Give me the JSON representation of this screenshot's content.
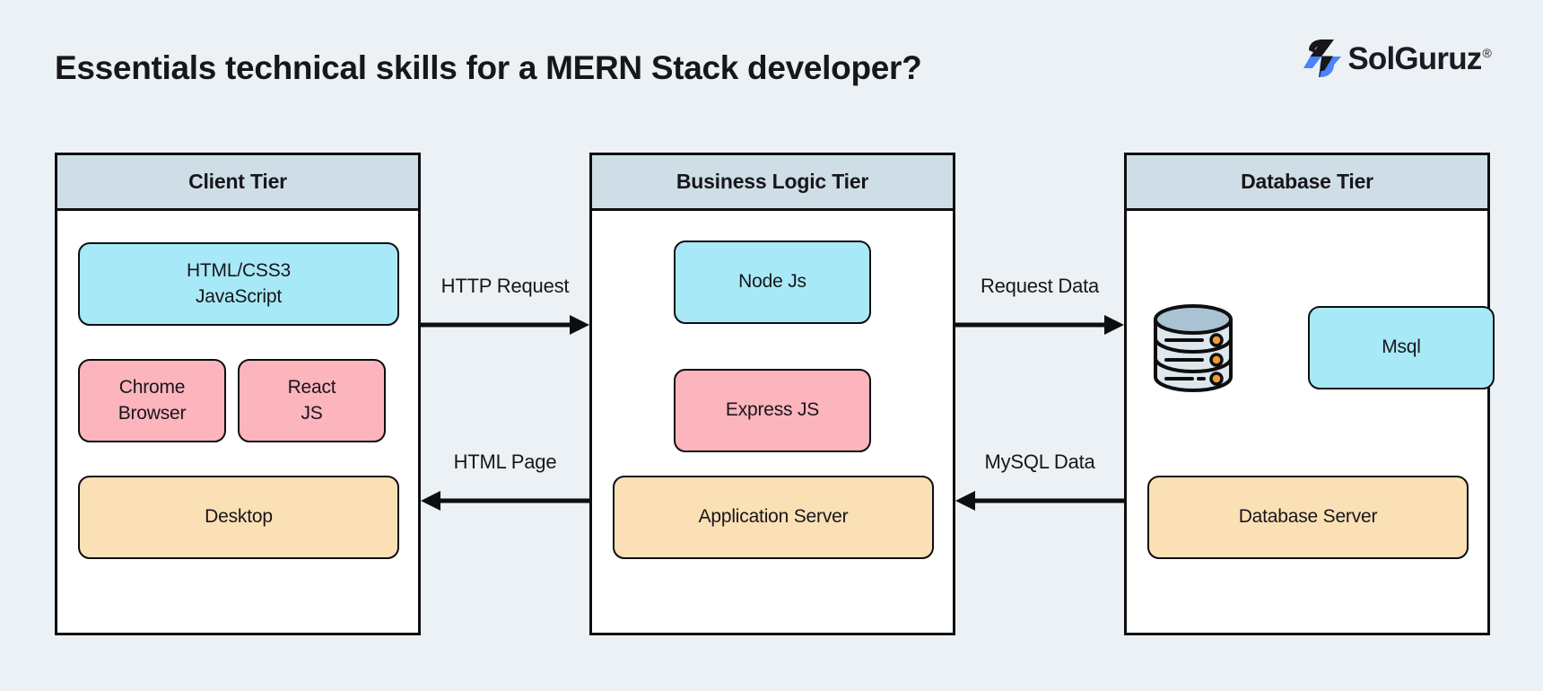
{
  "header": {
    "title": "Essentials technical skills for a MERN Stack developer?",
    "logo_text": "SolGuruz",
    "logo_registered": "®",
    "logo_colors": {
      "blue": "#4b84fb",
      "dark": "#17161a"
    }
  },
  "palette": {
    "page_background": "#ecf1f5",
    "tier_header": "#cfdee6",
    "tier_body": "#ffffff",
    "outline": "#0e0e10",
    "cyan": "#a7e9f7",
    "pink": "#fcb4bd",
    "orange": "#fbe0b6",
    "db_icon_fill": "#dde7ec",
    "db_icon_top": "#a9c3d2",
    "db_icon_dot": "#f09a38"
  },
  "tiers": [
    {
      "id": "client",
      "title": "Client Tier",
      "nodes": [
        {
          "id": "htmlcss",
          "label": "HTML/CSS3\nJavaScript",
          "line1": "HTML/CSS3",
          "line2": "JavaScript",
          "color": "cyan"
        },
        {
          "id": "chrome",
          "label": "Chrome\nBrowser",
          "line1": "Chrome",
          "line2": "Browser",
          "color": "pink"
        },
        {
          "id": "react",
          "label": "React\nJS",
          "line1": "React",
          "line2": "JS",
          "color": "pink"
        },
        {
          "id": "desktop",
          "label": "Desktop",
          "color": "orange"
        }
      ]
    },
    {
      "id": "business",
      "title": "Business Logic Tier",
      "nodes": [
        {
          "id": "nodejs",
          "label": "Node Js",
          "color": "cyan"
        },
        {
          "id": "express",
          "label": "Express JS",
          "color": "pink"
        },
        {
          "id": "appsrv",
          "label": "Application Server",
          "color": "orange"
        }
      ]
    },
    {
      "id": "database",
      "title": "Database Tier",
      "nodes": [
        {
          "id": "msql",
          "label": "Msql",
          "color": "cyan"
        },
        {
          "id": "dbsrv",
          "label": "Database Server",
          "color": "orange"
        }
      ],
      "icon": "database-cylinder-icon"
    }
  ],
  "connectors": [
    {
      "id": "http",
      "label": "HTTP Request",
      "direction": "right",
      "from": "client",
      "to": "business"
    },
    {
      "id": "html",
      "label": "HTML Page",
      "direction": "left",
      "from": "business",
      "to": "client"
    },
    {
      "id": "reqdata",
      "label": "Request Data",
      "direction": "right",
      "from": "business",
      "to": "database"
    },
    {
      "id": "mysql",
      "label": "MySQL Data",
      "direction": "left",
      "from": "database",
      "to": "business"
    }
  ]
}
